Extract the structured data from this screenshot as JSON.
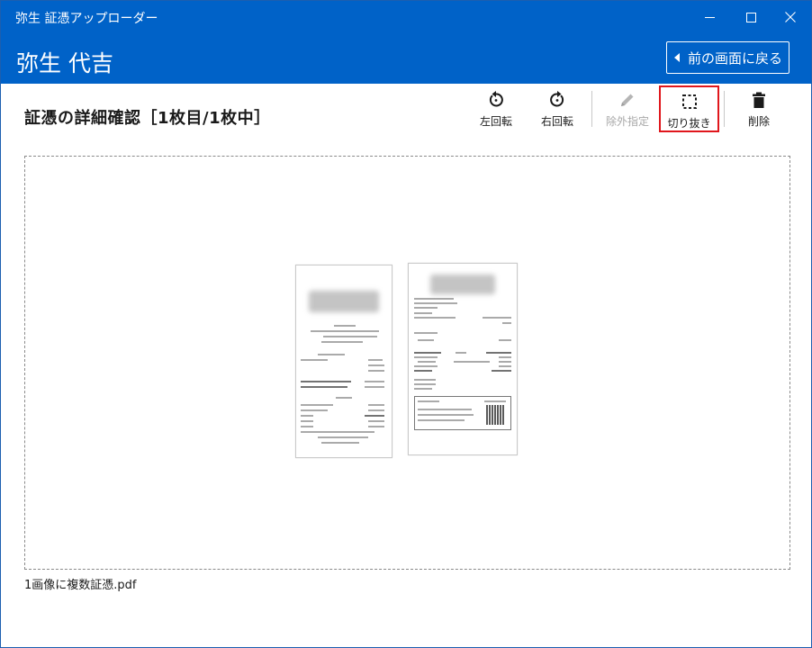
{
  "window": {
    "app_title": "弥生 証憑アップローダー",
    "controls": {
      "minimize_icon": "minimize-icon",
      "maximize_icon": "maximize-icon",
      "close_icon": "close-icon"
    }
  },
  "header": {
    "company_name": "弥生 代吉",
    "back_button_label": "前の画面に戻る"
  },
  "page": {
    "title": "証憑の詳細確認［1枚目/1枚中］"
  },
  "toolbar": {
    "rotate_left": {
      "label": "左回転",
      "icon": "rotate-left-icon",
      "enabled": true
    },
    "rotate_right": {
      "label": "右回転",
      "icon": "rotate-right-icon",
      "enabled": true
    },
    "exclude": {
      "label": "除外指定",
      "icon": "pencil-icon",
      "enabled": false
    },
    "crop": {
      "label": "切り抜き",
      "icon": "crop-icon",
      "enabled": true,
      "highlighted": true
    },
    "delete": {
      "label": "削除",
      "icon": "trash-icon",
      "enabled": true
    }
  },
  "preview": {
    "file_name": "1画像に複数証憑.pdf"
  },
  "colors": {
    "brand_blue": "#0062c8",
    "highlight_red": "#e0161c",
    "disabled_gray": "#a8a8a8"
  }
}
